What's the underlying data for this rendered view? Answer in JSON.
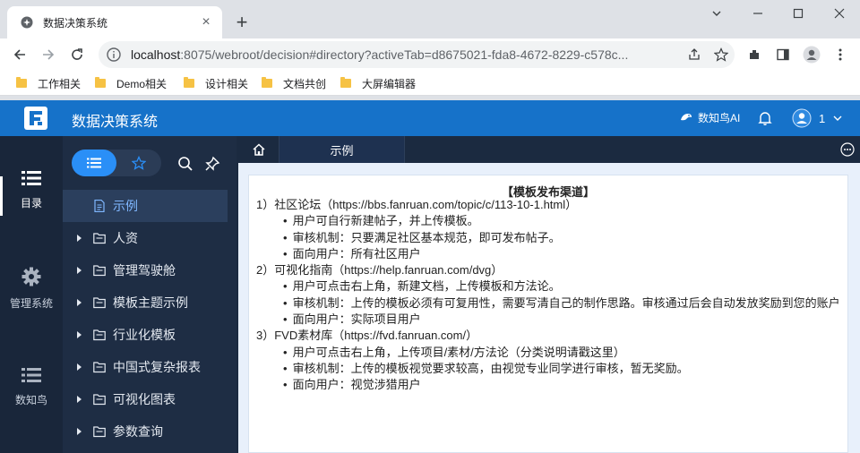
{
  "browser": {
    "tab_title": "数据决策系统",
    "url_host": "localhost",
    "url_rest": ":8075/webroot/decision#directory?activeTab=d8675021-fda8-4672-8229-c578c...",
    "bookmarks": [
      "工作相关",
      "Demo相关",
      "设计相关",
      "文档共创",
      "大屏编辑器"
    ]
  },
  "app": {
    "title": "数据决策系统",
    "ai_label": "数知鸟AI",
    "user_label": "1",
    "brand_color": "#1672c9"
  },
  "rail": {
    "items": [
      {
        "label": "目录",
        "icon": "list-icon"
      },
      {
        "label": "管理系统",
        "icon": "gear-icon"
      },
      {
        "label": "数知鸟",
        "icon": "list-icon"
      }
    ]
  },
  "directory": {
    "items": [
      {
        "label": "示例",
        "type": "report",
        "active": true
      },
      {
        "label": "人资",
        "type": "folder"
      },
      {
        "label": "管理驾驶舱",
        "type": "folder"
      },
      {
        "label": "模板主题示例",
        "type": "folder"
      },
      {
        "label": "行业化模板",
        "type": "folder"
      },
      {
        "label": "中国式复杂报表",
        "type": "folder"
      },
      {
        "label": "可视化图表",
        "type": "folder"
      },
      {
        "label": "参数查询",
        "type": "folder"
      }
    ]
  },
  "tabs": {
    "current": "示例"
  },
  "report": {
    "title": "【模板发布渠道】",
    "lines": [
      {
        "text": "1）社区论坛（https://bbs.fanruan.com/topic/c/113-10-1.html）",
        "sub": false
      },
      {
        "text": "用户可自行新建帖子，并上传模板。",
        "sub": true
      },
      {
        "text": "审核机制：只要满足社区基本规范，即可发布帖子。",
        "sub": true
      },
      {
        "text": "面向用户：所有社区用户",
        "sub": true
      },
      {
        "text": "2）可视化指南（https://help.fanruan.com/dvg）",
        "sub": false
      },
      {
        "text": "用户可点击右上角，新建文档，上传模板和方法论。",
        "sub": true
      },
      {
        "text": "审核机制：上传的模板必须有可复用性，需要写清自己的制作思路。审核通过后会自动发放奖励到您的账户",
        "sub": true
      },
      {
        "text": "面向用户：实际项目用户",
        "sub": true
      },
      {
        "text": "3）FVD素材库（https://fvd.fanruan.com/）",
        "sub": false
      },
      {
        "text": "用户可点击右上角，上传项目/素材/方法论（分类说明请戳这里）",
        "sub": true
      },
      {
        "text": "审核机制：上传的模板视觉要求较高，由视觉专业同学进行审核，暂无奖励。",
        "sub": true
      },
      {
        "text": "面向用户：视觉涉猎用户",
        "sub": true
      }
    ]
  }
}
